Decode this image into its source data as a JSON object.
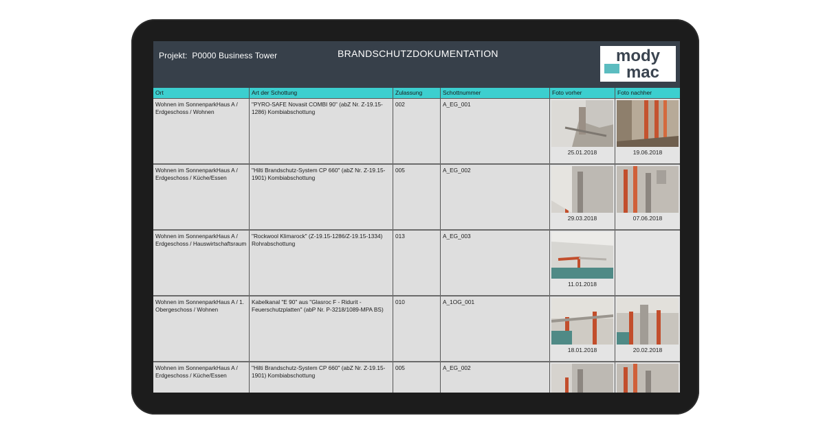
{
  "header": {
    "project_label": "Projekt:",
    "project_name": "P0000 Business Tower",
    "title": "BRANDSCHUTZDOKUMENTATION",
    "logo_top": "mody",
    "logo_bottom": "mac"
  },
  "columns": [
    "Ort",
    "Art der Schottung",
    "Zulassung",
    "Schottnummer",
    "Foto vorher",
    "Foto nachher"
  ],
  "rows": [
    {
      "ort": "Wohnen im SonnenparkHaus A / Erdgeschoss / Wohnen",
      "art": "\"PYRO-SAFE Novasit COMBI 90\" (abZ Nr. Z-19.15-1286) Kombiabschottung",
      "zulassung": "002",
      "schottnummer": "A_EG_001",
      "foto_vorher_date": "25.01.2018",
      "foto_nachher_date": "19.06.2018"
    },
    {
      "ort": "Wohnen im SonnenparkHaus A / Erdgeschoss / Küche/Essen",
      "art": "\"Hilti Brandschutz-System CP 660\" (abZ Nr. Z-19.15-1901) Kombiabschottung",
      "zulassung": "005",
      "schottnummer": "A_EG_002",
      "foto_vorher_date": "29.03.2018",
      "foto_nachher_date": "07.06.2018"
    },
    {
      "ort": "Wohnen im SonnenparkHaus A / Erdgeschoss / Hauswirtschaftsraum",
      "art": "\"Rockwool Klimarock\" (Z-19.15-1286/Z-19.15-1334) Rohrabschottung",
      "zulassung": "013",
      "schottnummer": "A_EG_003",
      "foto_vorher_date": "11.01.2018",
      "foto_nachher_date": ""
    },
    {
      "ort": "Wohnen im SonnenparkHaus A / 1. Obergeschoss / Wohnen",
      "art": "Kabelkanal \"E 90\" aus \"Glasroc F - Ridurit - Feuerschutzplatten\" (abP Nr. P-3218/1089-MPA BS)",
      "zulassung": "010",
      "schottnummer": "A_1OG_001",
      "foto_vorher_date": "18.01.2018",
      "foto_nachher_date": "20.02.2018"
    },
    {
      "ort": "Wohnen im SonnenparkHaus A / Erdgeschoss / Küche/Essen",
      "art": "\"Hilti Brandschutz-System CP 660\" (abZ Nr. Z-19.15-1901) Kombiabschottung",
      "zulassung": "005",
      "schottnummer": "A_EG_002",
      "foto_vorher_date": "",
      "foto_nachher_date": ""
    }
  ],
  "colors": {
    "header_bg": "#37404a",
    "table_header_bg": "#3ccfcf",
    "logo_accent": "#5bbcc0"
  }
}
